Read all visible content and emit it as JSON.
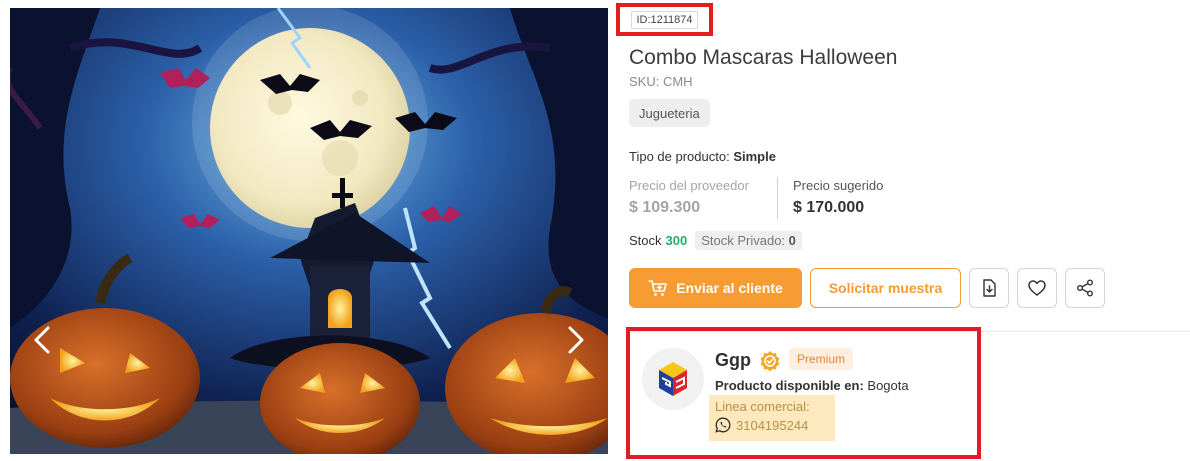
{
  "gallery": {
    "image_icon": "halloween-product-image",
    "prev_icon": "chevron-left-icon",
    "next_icon": "chevron-right-icon"
  },
  "product": {
    "id_label": "ID:1211874",
    "title": "Combo Mascaras Halloween",
    "sku": "SKU: CMH",
    "category": "Jugueteria",
    "type_label": "Tipo de producto:",
    "type_value": "Simple",
    "supplier_price_label": "Precio del proveedor",
    "supplier_price": "$ 109.300",
    "suggested_price_label": "Precio sugerido",
    "suggested_price": "$ 170.000",
    "stock_label": "Stock",
    "stock_value": "300",
    "private_stock_label": "Stock Privado:",
    "private_stock_value": "0"
  },
  "actions": {
    "send_label": "Enviar al cliente",
    "send_icon": "cart-plus-icon",
    "sample_label": "Solicitar muestra",
    "download_icon": "file-download-icon",
    "favorite_icon": "heart-icon",
    "share_icon": "share-icon"
  },
  "supplier": {
    "name": "Ggp",
    "badge_icon": "premium-badge-icon",
    "tier": "Premium",
    "availability_label": "Producto disponible en:",
    "availability_city": "Bogota",
    "commercial_label": "Linea comercial:",
    "phone_icon": "whatsapp-icon",
    "phone": "3104195244"
  },
  "colors": {
    "accent": "#f79b33",
    "highlight": "#e31b23",
    "stock": "#21b066",
    "commercial_bg": "#fde9bd"
  }
}
